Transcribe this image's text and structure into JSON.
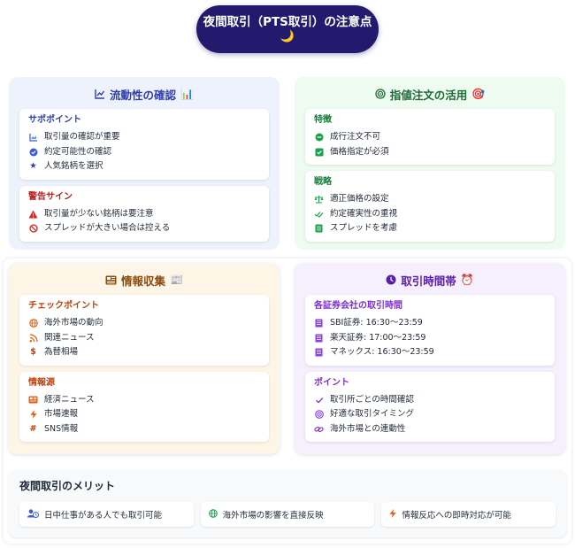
{
  "header": {
    "title": "夜間取引（PTS取引）の注意点",
    "emoji": "🌙"
  },
  "liquidity": {
    "title": "流動性の確認",
    "title_icon": "chart-line-icon",
    "title_emoji": "📊",
    "support": {
      "title": "サポポイント",
      "items": [
        {
          "icon": "chart-area-icon",
          "text": "取引量の確認が重要"
        },
        {
          "icon": "check-circle-icon",
          "text": "約定可能性の確認"
        },
        {
          "icon": "star-icon",
          "text": "人気銘柄を選択"
        }
      ]
    },
    "warning": {
      "title": "警告サイン",
      "items": [
        {
          "icon": "warning-triangle-icon",
          "text": "取引量が少ない銘柄は要注意"
        },
        {
          "icon": "ban-icon",
          "text": "スプレッドが大きい場合は控える"
        }
      ]
    }
  },
  "limit_order": {
    "title": "指値注文の活用",
    "title_icon": "bullseye-icon",
    "title_emoji": "🎯",
    "features": {
      "title": "特徴",
      "items": [
        {
          "icon": "check-circle-icon",
          "text": "成行注文不可"
        },
        {
          "icon": "check-square-icon",
          "text": "価格指定が必須"
        }
      ]
    },
    "strategy": {
      "title": "戦略",
      "items": [
        {
          "icon": "balance-scale-icon",
          "text": "適正価格の設定"
        },
        {
          "icon": "double-check-icon",
          "text": "約定確実性の重視"
        },
        {
          "icon": "file-icon",
          "text": "スプレッドを考慮"
        }
      ]
    }
  },
  "info": {
    "title": "情報収集",
    "title_icon": "newspaper-icon",
    "title_emoji": "📰",
    "checkpoints": {
      "title": "チェックポイント",
      "items": [
        {
          "icon": "globe-icon",
          "text": "海外市場の動向"
        },
        {
          "icon": "rss-icon",
          "text": "関連ニュース"
        },
        {
          "icon": "dollar-icon",
          "text": "為替相場"
        }
      ]
    },
    "sources": {
      "title": "情報源",
      "items": [
        {
          "icon": "newspaper-icon",
          "text": "経済ニュース"
        },
        {
          "icon": "bolt-icon",
          "text": "市場速報"
        },
        {
          "icon": "hashtag-icon",
          "text": "SNS情報"
        }
      ]
    }
  },
  "hours": {
    "title": "取引時間帯",
    "title_icon": "clock-icon",
    "title_emoji": "⏰",
    "brokers": {
      "title": "各証券会社の取引時間",
      "items": [
        {
          "icon": "building-icon",
          "text": "SBI証券: 16:30～23:59"
        },
        {
          "icon": "building-icon",
          "text": "楽天証券: 17:00～23:59"
        },
        {
          "icon": "building-icon",
          "text": "マネックス: 16:30～23:59"
        }
      ]
    },
    "points": {
      "title": "ポイント",
      "items": [
        {
          "icon": "check-icon",
          "text": "取引所ごとの時間確認"
        },
        {
          "icon": "target-icon",
          "text": "好適な取引タイミング"
        },
        {
          "icon": "link-icon",
          "text": "海外市場との連動性"
        }
      ]
    }
  },
  "merits": {
    "title": "夜間取引のメリット",
    "items": [
      {
        "icon": "user-clock-icon",
        "text": "日中仕事がある人でも取引可能"
      },
      {
        "icon": "globe-icon",
        "text": "海外市場の影響を直接反映"
      },
      {
        "icon": "bolt-icon",
        "text": "情報反応への即時対応が可能"
      }
    ]
  },
  "colors": {
    "title_bg": "#231a6e",
    "blue": "#2f3db0",
    "green": "#1e6b36",
    "orange": "#8a4b10",
    "purple": "#5a1fa8",
    "red": "#b91c1c"
  }
}
